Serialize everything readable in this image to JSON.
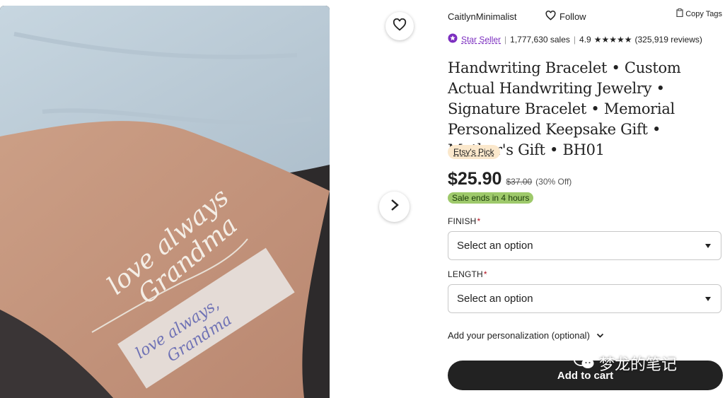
{
  "shop": {
    "name": "CaitlynMinimalist",
    "follow_label": "Follow",
    "copy_tags_label": "Copy Tags",
    "star_seller_label": "Star Seller",
    "sales": "1,777,630 sales",
    "rating": "4.9",
    "stars": "★★★★★",
    "reviews": "(325,919 reviews)"
  },
  "product": {
    "title": "Handwriting Bracelet • Custom Actual Handwriting Jewelry • Signature Bracelet • Memorial Personalized Keepsake Gift • Mother's Gift • BH01",
    "badge": "Etsy's Pick",
    "price": "$25.90",
    "original_price": "$37.00",
    "discount": "(30% Off)",
    "sale_notice": "Sale ends in 4 hours"
  },
  "options": {
    "finish_label": "FINISH",
    "finish_value": "Select an option",
    "length_label": "LENGTH",
    "length_value": "Select an option",
    "required_mark": "*"
  },
  "personalization_label": "Add your personalization (optional)",
  "cart_label": "Add to cart",
  "watermark_text": "梦龙的笔记",
  "photo": {
    "bracelet_text_1": "love always",
    "bracelet_text_2": "Grandma",
    "paper_text_1": "love always,",
    "paper_text_2": "Grandma"
  },
  "icons": {
    "favorite": "heart-outline-icon",
    "next": "chevron-right-icon",
    "follow": "heart-outline-icon",
    "copy": "clipboard-icon",
    "star_seller": "star-seller-badge-icon",
    "expand": "chevron-down-icon"
  },
  "colors": {
    "star_seller": "#7b2dbf",
    "etsy_pick_bg": "#fbe8cc",
    "sale_bg": "#9ec96b",
    "cart_bg": "#222222",
    "required": "#b3101e"
  }
}
